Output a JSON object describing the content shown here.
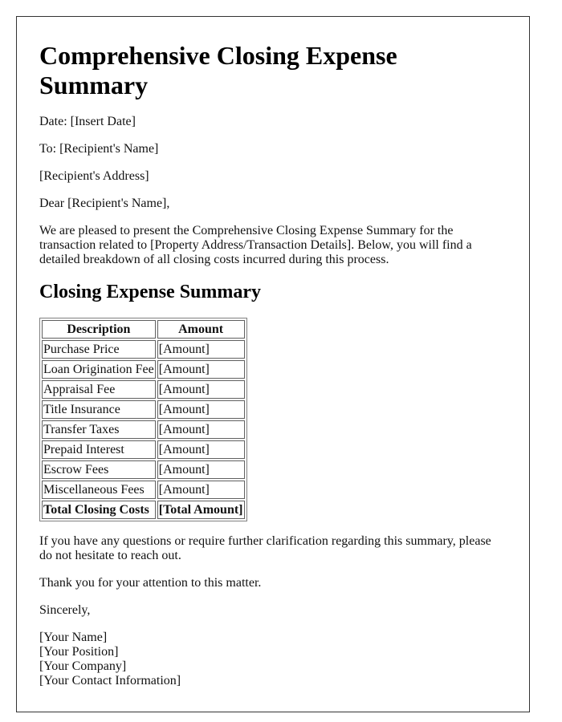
{
  "title": "Comprehensive Closing Expense Summary",
  "date_line": "Date: [Insert Date]",
  "to_line": "To: [Recipient's Name]",
  "address_line": "[Recipient's Address]",
  "salutation": "Dear [Recipient's Name],",
  "intro_paragraph": "We are pleased to present the Comprehensive Closing Expense Summary for the transaction related to [Property Address/Transaction Details]. Below, you will find a detailed breakdown of all closing costs incurred during this process.",
  "section_heading": "Closing Expense Summary",
  "table": {
    "headers": [
      "Description",
      "Amount"
    ],
    "rows": [
      {
        "description": "Purchase Price",
        "amount": "[Amount]"
      },
      {
        "description": "Loan Origination Fee",
        "amount": "[Amount]"
      },
      {
        "description": "Appraisal Fee",
        "amount": "[Amount]"
      },
      {
        "description": "Title Insurance",
        "amount": "[Amount]"
      },
      {
        "description": "Transfer Taxes",
        "amount": "[Amount]"
      },
      {
        "description": "Prepaid Interest",
        "amount": "[Amount]"
      },
      {
        "description": "Escrow Fees",
        "amount": "[Amount]"
      },
      {
        "description": "Miscellaneous Fees",
        "amount": "[Amount]"
      }
    ],
    "total": {
      "description": "Total Closing Costs",
      "amount": "[Total Amount]"
    }
  },
  "questions_paragraph": "If you have any questions or require further clarification regarding this summary, please do not hesitate to reach out.",
  "thanks_paragraph": "Thank you for your attention to this matter.",
  "closing": "Sincerely,",
  "signature": {
    "name": "[Your Name]",
    "position": "[Your Position]",
    "company": "[Your Company]",
    "contact": "[Your Contact Information]"
  }
}
